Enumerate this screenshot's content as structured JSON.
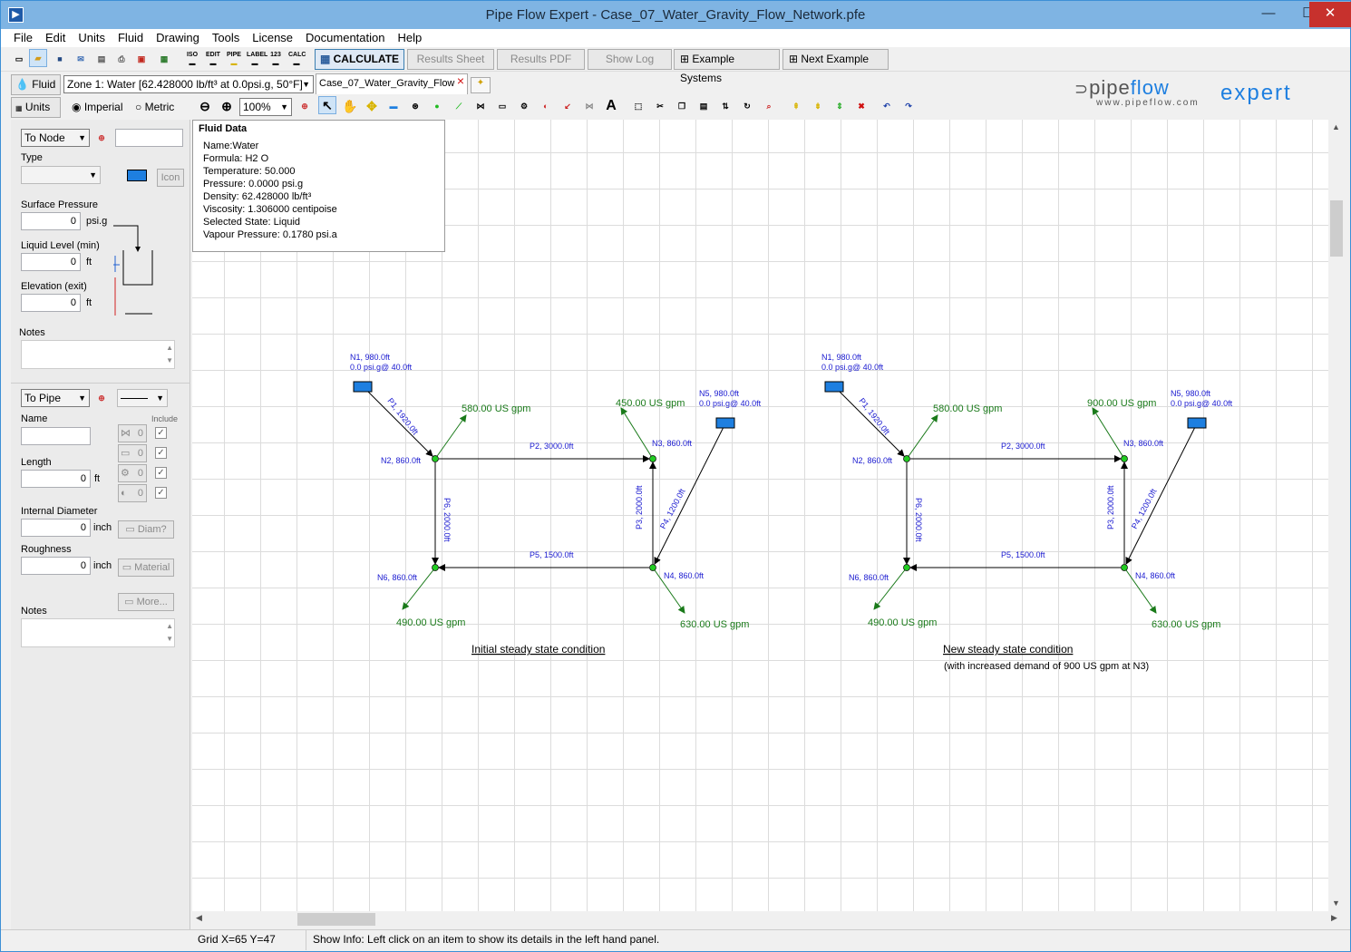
{
  "window": {
    "title": "Pipe Flow Expert - Case_07_Water_Gravity_Flow_Network.pfe"
  },
  "menu": [
    "File",
    "Edit",
    "Units",
    "Fluid",
    "Drawing",
    "Tools",
    "License",
    "Documentation",
    "Help"
  ],
  "toolbar1": {
    "labels": [
      "ISO",
      "EDIT",
      "PIPE",
      "LABEL",
      "123",
      "CALC"
    ],
    "calculate": "CALCULATE",
    "results_sheet": "Results Sheet",
    "results_pdf": "Results PDF",
    "show_log": "Show Log",
    "example_systems": "Example Systems",
    "next_example": "Next Example"
  },
  "toolbar2": {
    "fluid_button": "Fluid",
    "zone_combo": "Zone 1: Water [62.428000 lb/ft³ at 0.0psi.g, 50°F]",
    "doc_tab": "Case_07_Water_Gravity_Flow",
    "close_mark": "×"
  },
  "toolbar3": {
    "units_button": "Units",
    "imperial": "Imperial",
    "metric": "Metric",
    "zoom": "100%",
    "text_tool": "A"
  },
  "logo": {
    "name_a": "pipe",
    "name_b": "flow",
    "name_c": "expert",
    "url": "www.pipeflow.com"
  },
  "left_panel": {
    "node_combo": "To Node",
    "type_label": "Type",
    "icon_button": "Icon",
    "surface_pressure_label": "Surface Pressure",
    "surface_pressure_value": "0",
    "surface_pressure_unit": "psi.g",
    "liquid_level_label": "Liquid Level (min)",
    "liquid_level_value": "0",
    "liquid_level_unit": "ft",
    "elevation_label": "Elevation (exit)",
    "elevation_value": "0",
    "elevation_unit": "ft",
    "notes_label": "Notes",
    "pipe_combo": "To Pipe",
    "include_label": "Include",
    "name_label": "Name",
    "length_label": "Length",
    "length_value": "0",
    "length_unit": "ft",
    "fitting_counts": [
      "0",
      "0",
      "0",
      "0"
    ],
    "internal_diameter_label": "Internal Diameter",
    "internal_diameter_value": "0",
    "internal_diameter_unit": "inch",
    "diam_button": "Diam?",
    "roughness_label": "Roughness",
    "roughness_value": "0",
    "roughness_unit": "inch",
    "material_button": "Material",
    "more_button": "More...",
    "notes2_label": "Notes"
  },
  "tooltip": {
    "heading": "Fluid Data",
    "rows": [
      "Name:Water",
      "Formula: H2 O",
      "Temperature: 50.000",
      "Pressure: 0.0000 psi.g",
      "Density: 62.428000 lb/ft³",
      "Viscosity: 1.306000 centipoise",
      "Selected State: Liquid",
      "Vapour Pressure: 0.1780 psi.a"
    ]
  },
  "networks": [
    {
      "n1": [
        "N1, 980.0ft",
        "0.0 psi.g@ 40.0ft"
      ],
      "n5": [
        "N5, 980.0ft",
        "0.0 psi.g@ 40.0ft"
      ],
      "n2": "N2, 860.0ft",
      "n3": "N3, 860.0ft",
      "n4": "N4, 860.0ft",
      "n6": "N6, 860.0ft",
      "p1": "P1, 1920.0ft",
      "p2": "P2, 3000.0ft",
      "p3": "P3, 2000.0ft",
      "p4": "P4, 1200.0ft",
      "p5": "P5, 1500.0ft",
      "p6": "P6, 2000.0ft",
      "d2": "580.00 US gpm",
      "d3": "450.00 US gpm",
      "d4": "630.00 US gpm",
      "d6": "490.00 US gpm",
      "caption": "Initial steady state condition",
      "subcaption": ""
    },
    {
      "n1": [
        "N1, 980.0ft",
        "0.0 psi.g@ 40.0ft"
      ],
      "n5": [
        "N5, 980.0ft",
        "0.0 psi.g@ 40.0ft"
      ],
      "n2": "N2, 860.0ft",
      "n3": "N3, 860.0ft",
      "n4": "N4, 860.0ft",
      "n6": "N6, 860.0ft",
      "p1": "P1, 1920.0ft",
      "p2": "P2, 3000.0ft",
      "p3": "P3, 2000.0ft",
      "p4": "P4, 1200.0ft",
      "p5": "P5, 1500.0ft",
      "p6": "P6, 2000.0ft",
      "d2": "580.00 US gpm",
      "d3": "900.00 US gpm",
      "d4": "630.00 US gpm",
      "d6": "490.00 US gpm",
      "caption": "New steady state condition",
      "subcaption": "(with increased demand of 900 US gpm at N3)"
    }
  ],
  "status": {
    "grid": "Grid  X=65  Y=47",
    "info": "Show Info: Left click on an item to show its details in the left hand panel."
  },
  "colors": {
    "pipe_label": "#1a1ad0",
    "demand": "#1a7a1a",
    "node": "#22cc22",
    "tank": "#1e7fe0"
  }
}
